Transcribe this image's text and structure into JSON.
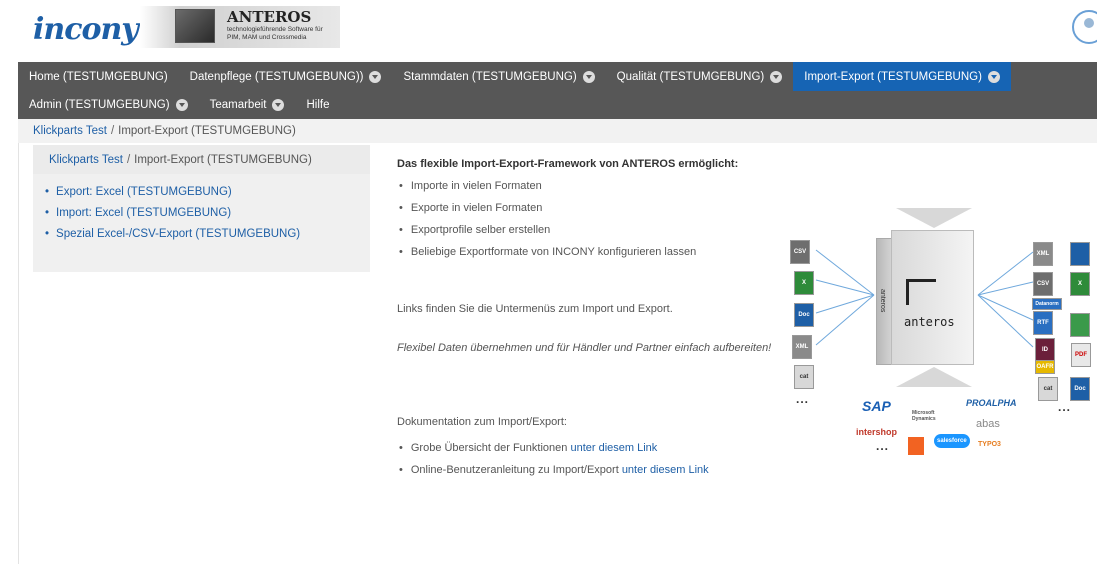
{
  "header": {
    "logo_text": "incony",
    "anteros_title": "ANTEROS",
    "anteros_subtitle": "technologieführende Software für PIM, MAM und Crossmedia"
  },
  "nav": {
    "row1": [
      {
        "label": "Home (TESTUMGEBUNG)",
        "dropdown": false,
        "active": false
      },
      {
        "label": "Datenpflege (TESTUMGEBUNG))",
        "dropdown": true,
        "active": false
      },
      {
        "label": "Stammdaten (TESTUMGEBUNG)",
        "dropdown": true,
        "active": false
      },
      {
        "label": "Qualität (TESTUMGEBUNG)",
        "dropdown": true,
        "active": false
      },
      {
        "label": "Import-Export (TESTUMGEBUNG)",
        "dropdown": true,
        "active": true
      }
    ],
    "row2": [
      {
        "label": "Admin (TESTUMGEBUNG)",
        "dropdown": true
      },
      {
        "label": "Teamarbeit",
        "dropdown": true
      },
      {
        "label": "Hilfe",
        "dropdown": false
      }
    ],
    "active_color": "#1664b4",
    "bar_color": "#575757"
  },
  "breadcrumb": {
    "root": "Klickparts Test",
    "separator": "/",
    "current": "Import-Export (TESTUMGEBUNG)"
  },
  "sidebar": {
    "crumb_root": "Klickparts Test",
    "crumb_separator": "/",
    "crumb_current": "Import-Export (TESTUMGEBUNG)",
    "items": [
      {
        "label": "Export: Excel (TESTUMGEBUNG)"
      },
      {
        "label": "Import: Excel (TESTUMGEBUNG)"
      },
      {
        "label": "Spezial Excel-/CSV-Export (TESTUMGEBUNG)"
      }
    ]
  },
  "main": {
    "heading": "Das flexible Import-Export-Framework von ANTEROS ermöglicht:",
    "features": [
      "Importe in vielen Formaten",
      "Exporte in vielen Formaten",
      "Exportprofile selber erstellen",
      "Beliebige Exportformate von INCONY konfigurieren lassen"
    ],
    "links_text": "Links finden Sie die Untermenüs zum Import und Export.",
    "flex_text": "Flexibel Daten übernehmen und für Händler und Partner einfach aufbereiten!",
    "doku_heading": "Dokumentation zum Import/Export:",
    "doc_items": [
      {
        "text": "Grobe Übersicht der Funktionen ",
        "link": "unter diesem Link"
      },
      {
        "text": "Online-Benutzeranleitung zu Import/Export ",
        "link": "unter diesem Link"
      }
    ]
  },
  "diagram": {
    "box_text": "anteros",
    "left_icons": [
      "CSV",
      "X",
      "Doc",
      "XML",
      "cat"
    ],
    "right_icons": [
      "XML",
      "CSV",
      "Datanorm",
      "RTF",
      "ID",
      "OAFR",
      "cat",
      "PDF",
      "X",
      "Doc"
    ],
    "dots": "...",
    "brands": [
      "SAP",
      "Microsoft Dynamics",
      "PROALPHA",
      "abas",
      "intershop",
      "salesforce",
      "TYPO3"
    ]
  }
}
